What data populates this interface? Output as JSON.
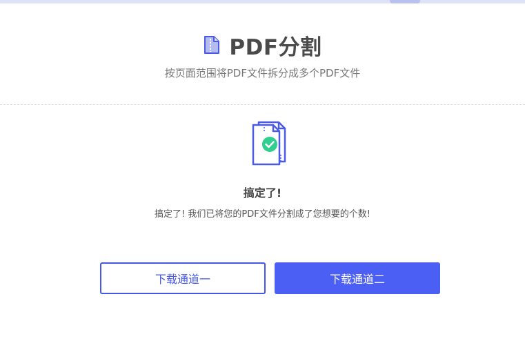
{
  "header": {
    "title": "PDF分割",
    "subtitle": "按页面范围将PDF文件拆分成多个PDF文件",
    "icon": "pdf-split-icon"
  },
  "result": {
    "icon": "split-success-icon",
    "title": "搞定了!",
    "message": "搞定了! 我们已将您的PDF文件分割成了您想要的个数!"
  },
  "actions": {
    "download_channel_1": "下载通道一",
    "download_channel_2": "下载通道二"
  },
  "colors": {
    "primary": "#4b5ff5",
    "outline": "#4657e8",
    "success": "#2ecf8f",
    "top_bar": "#dde2f7"
  }
}
